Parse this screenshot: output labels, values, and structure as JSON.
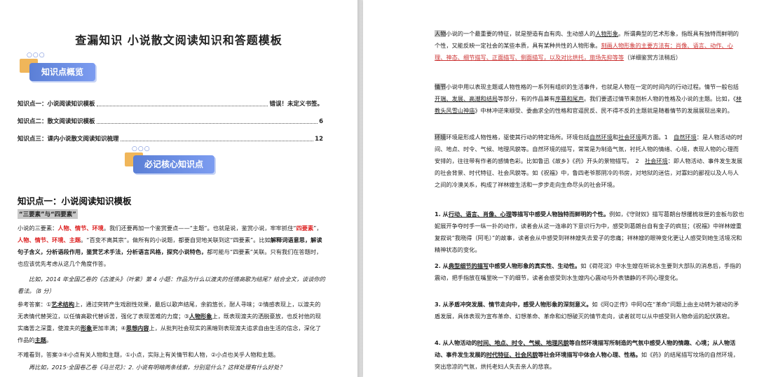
{
  "left_page": {
    "doc_title": "查漏知识 小说散文阅读知识和答题模板",
    "badge_overview": "知识点概览",
    "badge_core": "必记核心知识点",
    "toc": [
      {
        "label": "知识点一：小说阅读知识模板",
        "page": "错误！未定义书签。"
      },
      {
        "label": "知识点二：散文阅读知识模板",
        "page": "6"
      },
      {
        "label": "知识点三：课内小说散文阅读知识梳理",
        "page": "12"
      }
    ],
    "section_heading": "知识点一：小说阅读知识模板",
    "highlight_tag": "“三要素”与“四要素”",
    "para1": {
      "a": "小说的三要素：",
      "b": "人物、情节、环境",
      "c": "。我们还要再加一个鉴赏要点——“主题”。也就是说，鉴赏小说，牢牢抓住“",
      "d": "四要素",
      "e": "”，",
      "f": "人物、情节、环境、主题",
      "g": "。“百变不离其宗”。做所有的小说题，都要自觉地关联到这“四要素”。比如",
      "h": "解释词语意思，解读句子含义，分析语段作用，鉴赏艺术手法，分析语言风格，探究小说特色，",
      "i": "都可能与“四要素”关联。只有我们在答题时，也应该优先考虑从这几个角度作答。"
    },
    "para2": "比如，2014 年全国乙卷的《古渡头》（叶紫）第 4 小题：作品为什么以渡夫的任情高歌为结尾？结合全文，谈谈你的看法。（8 分）",
    "para3": {
      "a": "参考答案：①",
      "b": "艺术结构",
      "c": "上，通过突转产生戏剧性效果，最后以歌声结尾，余韵悠长，耐人寻味；②情感表现上，以渡夫的无表情代替哭泣，以任情高歌代替诉苦，强化了表现苦难的力度；③",
      "d": "人物形象",
      "e": "上，既表现渡夫的洒脱豪放，也反衬他的现实痛苦之深重，使渡夫的",
      "f": "形象",
      "g": "更加丰满；④",
      "h": "思想内容",
      "i": "上，从批判社会现实的黑暗到表现渡夫追求自由生活的信念，深化了作品的",
      "j": "主题",
      "k": "。"
    },
    "para4": "不难看到，答案③④小点有关人物和主题，①小点，实际上有关情节和人物，②小点也关乎人物和主题。",
    "para5": "再比如，2015·全国卷乙卷《马兰花》：2. 小说有明暗两条线索，分别是什么？这样处理有什么好处？"
  },
  "right_page": {
    "p1": {
      "a": "人物",
      "b": "小说的一个最重要的特征，就是塑造有血有肉、生动感人的",
      "c": "人物形象",
      "d": "。所谓典型的艺术形象，指既具有独特而鲜明的个性，又能反映一定社会的某些本质，具有某种共性的人物形象。",
      "e": "刻画人物形象的主要方法有：肖像、语言、动作、心理、神态、细节描写、正面描写、侧面描写，以及对比烘托，旅场先抑等等",
      "f": "（详细鉴赏方法稍后）"
    },
    "p2": {
      "a": "情节",
      "b": "小说中用以表现主题或人物性格的一系列有组织的生活事件，也就是人物在一定的时间内的行动过程。情节一般包括",
      "c": "开端、发展、高潮和结局",
      "d": "等部分，有的作品兼有",
      "e": "序幕和尾声",
      "f": "。我们要透过情节来剖析人物的性格及小说的主题。比如，《",
      "g": "林教头风雪山神庙",
      "h": "》中林冲逆来顺受、委曲求全的性格和官逼民反、民不得不反的主题就是随着情节的发展展现出来的。"
    },
    "p3": {
      "a": "环境",
      "b": "环境是形成人物性格，驱使其行动的特定场所。环境包括",
      "c": "自然环境",
      "d": "和",
      "e": "社会环境",
      "f": "两方面。1　",
      "g": "自然环境",
      "h": "：是人物活动的时间、地点、时令、气候、地理风貌等。自然环境的描写，常常是为制造气氛，衬托人物的情绪、心境，表现人物的心理而安排的，往往带有作者的感情色彩。比如鲁迅《故乡》《药》开头的景物描写。　2　",
      "i": "社会环境",
      "j": "：即人物活动、事件发生发展的社会背景、时代特征、社会风貌等。如《祝福》中，鲁四老爷那阴冷的书房，对地狱的迷信，对寡妇的鄙视以及人与人之间的冷漠关系，构成了祥林嫂生活和一步步走向生命尽头的社会环境。"
    },
    "p4": {
      "a": "1. 从",
      "b": "行动、语言、肖像、心理",
      "c": "等描写中感受人物独特而鲜明的个性。",
      "d": "例如，《守财奴》描写葛朗台想攫梳妆匣的金板与欧也妮展开争夺时手一纵一扑的动作，读者会从这一连串的下意识行为中，感受到葛朗台自有金子的疯狂；《祝福》中祥林嫂重复叙说“我晓得（阿毛）”的故事，读者会从中感受到祥林嫂失去爱子的悲痛；祥林嫂的眼神变化更让人感受到她生活境况和精神状态的变化。"
    },
    "p5": {
      "a": "2. 从",
      "b": "典型细节的描写",
      "c": "中感受人物形象的真实性、生动性。",
      "d": "如《荷花淀》中水生嫂在听说水生要到大部队的消息后，手指的震动，把手指放在嘴里吮一下的细节，读者会感受到水生嫂内心震动与外表镇静的不同心理变化。"
    },
    "p6": {
      "a": "3. 从矛盾冲突发展、情节走向中，感受人物形象的深刻意义。",
      "b": "如《阿Q正传》中阿Q在“革命”问题上由主动转为被动的矛盾发展，具体表现为宣布革命、幻想革命、革命和幻想破灭的情节走向，读者就可以从中感受到人物命运的起伏跌宕。"
    },
    "p7": {
      "a": "4. 从人物活动的",
      "b": "时间、地点、时令、气候、地理风貌",
      "c": "等自然环境描写所制造的气氛中感受人物的情趣、心境；从人物活动、事件发生发展的",
      "d": "时代特征、社会风貌",
      "e": "等社会环境描写中体会人物心理、性格。",
      "f": "如《药》的结尾描写坟场的自然环境，突出悲凉的气氛，烘托老妇人失去亲人的悲哀。"
    }
  }
}
